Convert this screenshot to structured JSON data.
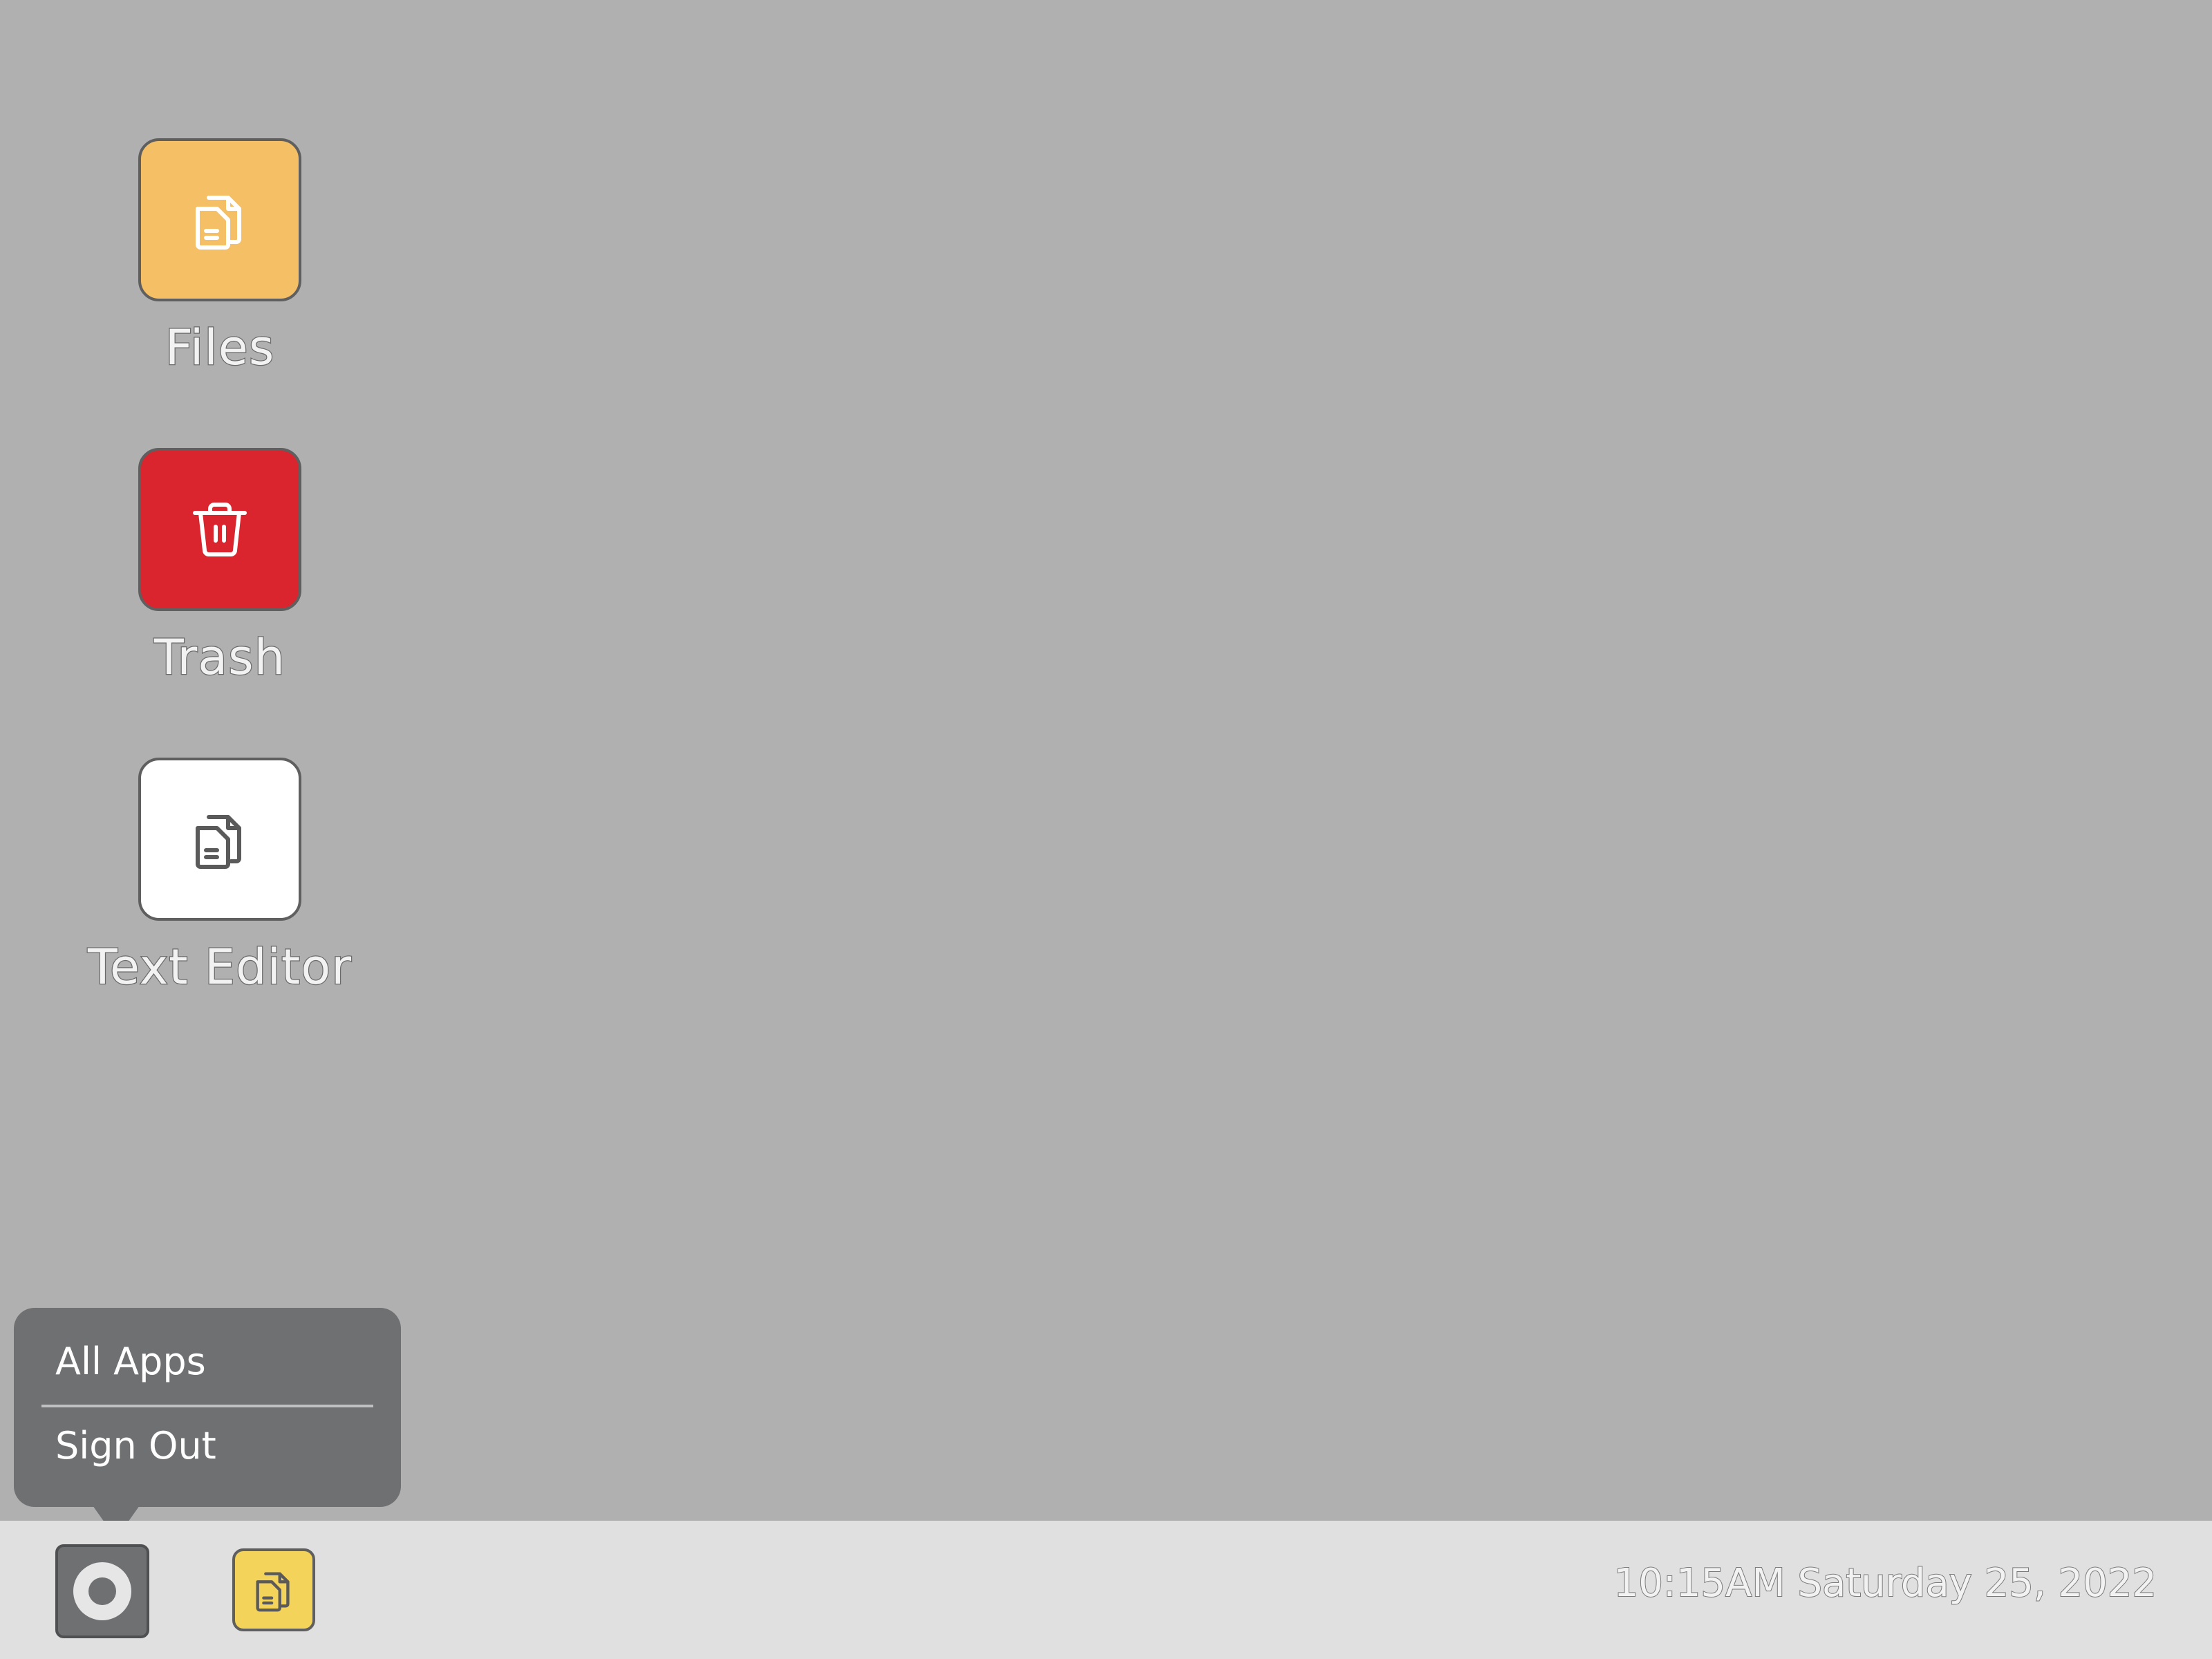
{
  "desktop": {
    "background": "#b0b0b0",
    "icons": [
      {
        "label": "Files",
        "icon": "files-icon",
        "color": "#f5bf65"
      },
      {
        "label": "Trash",
        "icon": "trash-icon",
        "color": "#da252e"
      },
      {
        "label": "Text Editor",
        "icon": "document-icon",
        "color": "#ffffff"
      }
    ]
  },
  "start_menu": {
    "items": [
      {
        "label": "All Apps"
      },
      {
        "label": "Sign Out"
      }
    ]
  },
  "taskbar": {
    "background": "#e0e0e0",
    "start_icon": "start-ring-icon",
    "pinned_app_icon": "document-icon",
    "pinned_app_color": "#f3d35a",
    "clock": "10:15AM Saturday 25, 2022"
  }
}
